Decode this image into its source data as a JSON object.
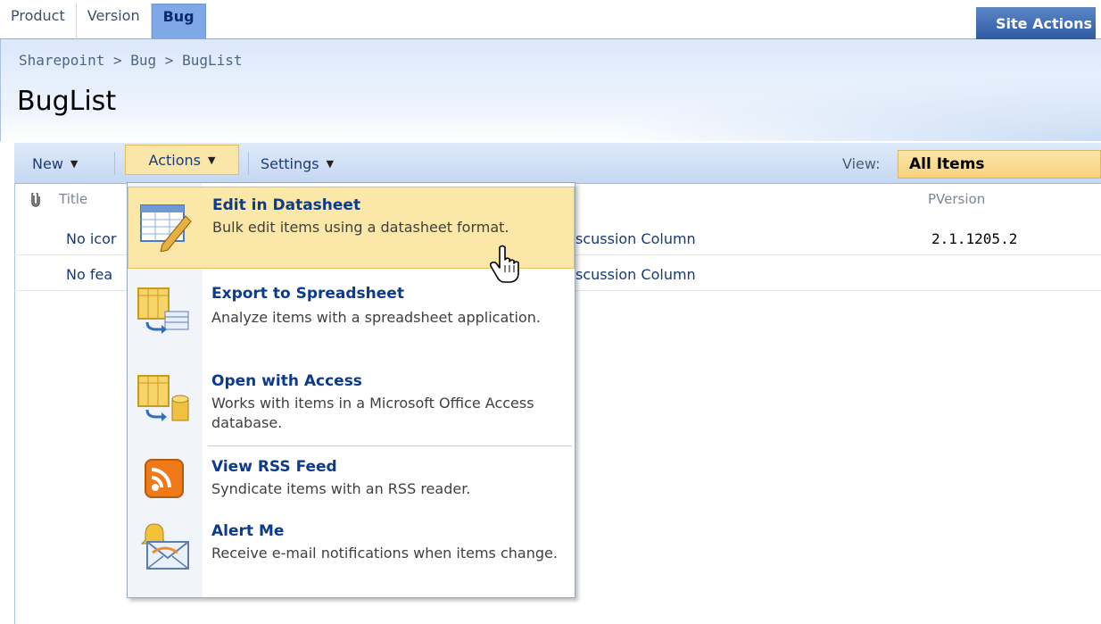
{
  "tabs": [
    "Product",
    "Version",
    "Bug"
  ],
  "active_tab": "Bug",
  "site_actions": "Site Actions",
  "breadcrumb": {
    "items": [
      "Sharepoint",
      "Bug",
      "BugList"
    ],
    "separator": ">"
  },
  "page_title": "BugList",
  "toolbar": {
    "new_label": "New",
    "actions_label": "Actions",
    "settings_label": "Settings",
    "view_label": "View:",
    "view_value": "All Items"
  },
  "list": {
    "columns": {
      "title": "Title",
      "pversion": "PVersion"
    },
    "rows": [
      {
        "title": "No icor",
        "discussion": "scussion Column",
        "pversion": "2.1.1205.2"
      },
      {
        "title": "No fea",
        "discussion": "scussion Column",
        "pversion": ""
      }
    ]
  },
  "menu": {
    "items": [
      {
        "title": "Edit in Datasheet",
        "desc": "Bulk edit items using a datasheet format.",
        "icon": "datasheet-edit-icon"
      },
      {
        "title": "Export to Spreadsheet",
        "desc": "Analyze items with a spreadsheet application.",
        "icon": "spreadsheet-export-icon"
      },
      {
        "title": "Open with Access",
        "desc": "Works with items in a Microsoft Office Access database.",
        "icon": "access-database-icon"
      },
      {
        "title": "View RSS Feed",
        "desc": "Syndicate items with an RSS reader.",
        "icon": "rss-feed-icon"
      },
      {
        "title": "Alert Me",
        "desc": "Receive e-mail notifications when items change.",
        "icon": "alert-bell-icon"
      }
    ]
  },
  "colors": {
    "accent": "#0b3b8c",
    "hover": "#fbe7a8",
    "toolbar": "#c5d7f2"
  }
}
